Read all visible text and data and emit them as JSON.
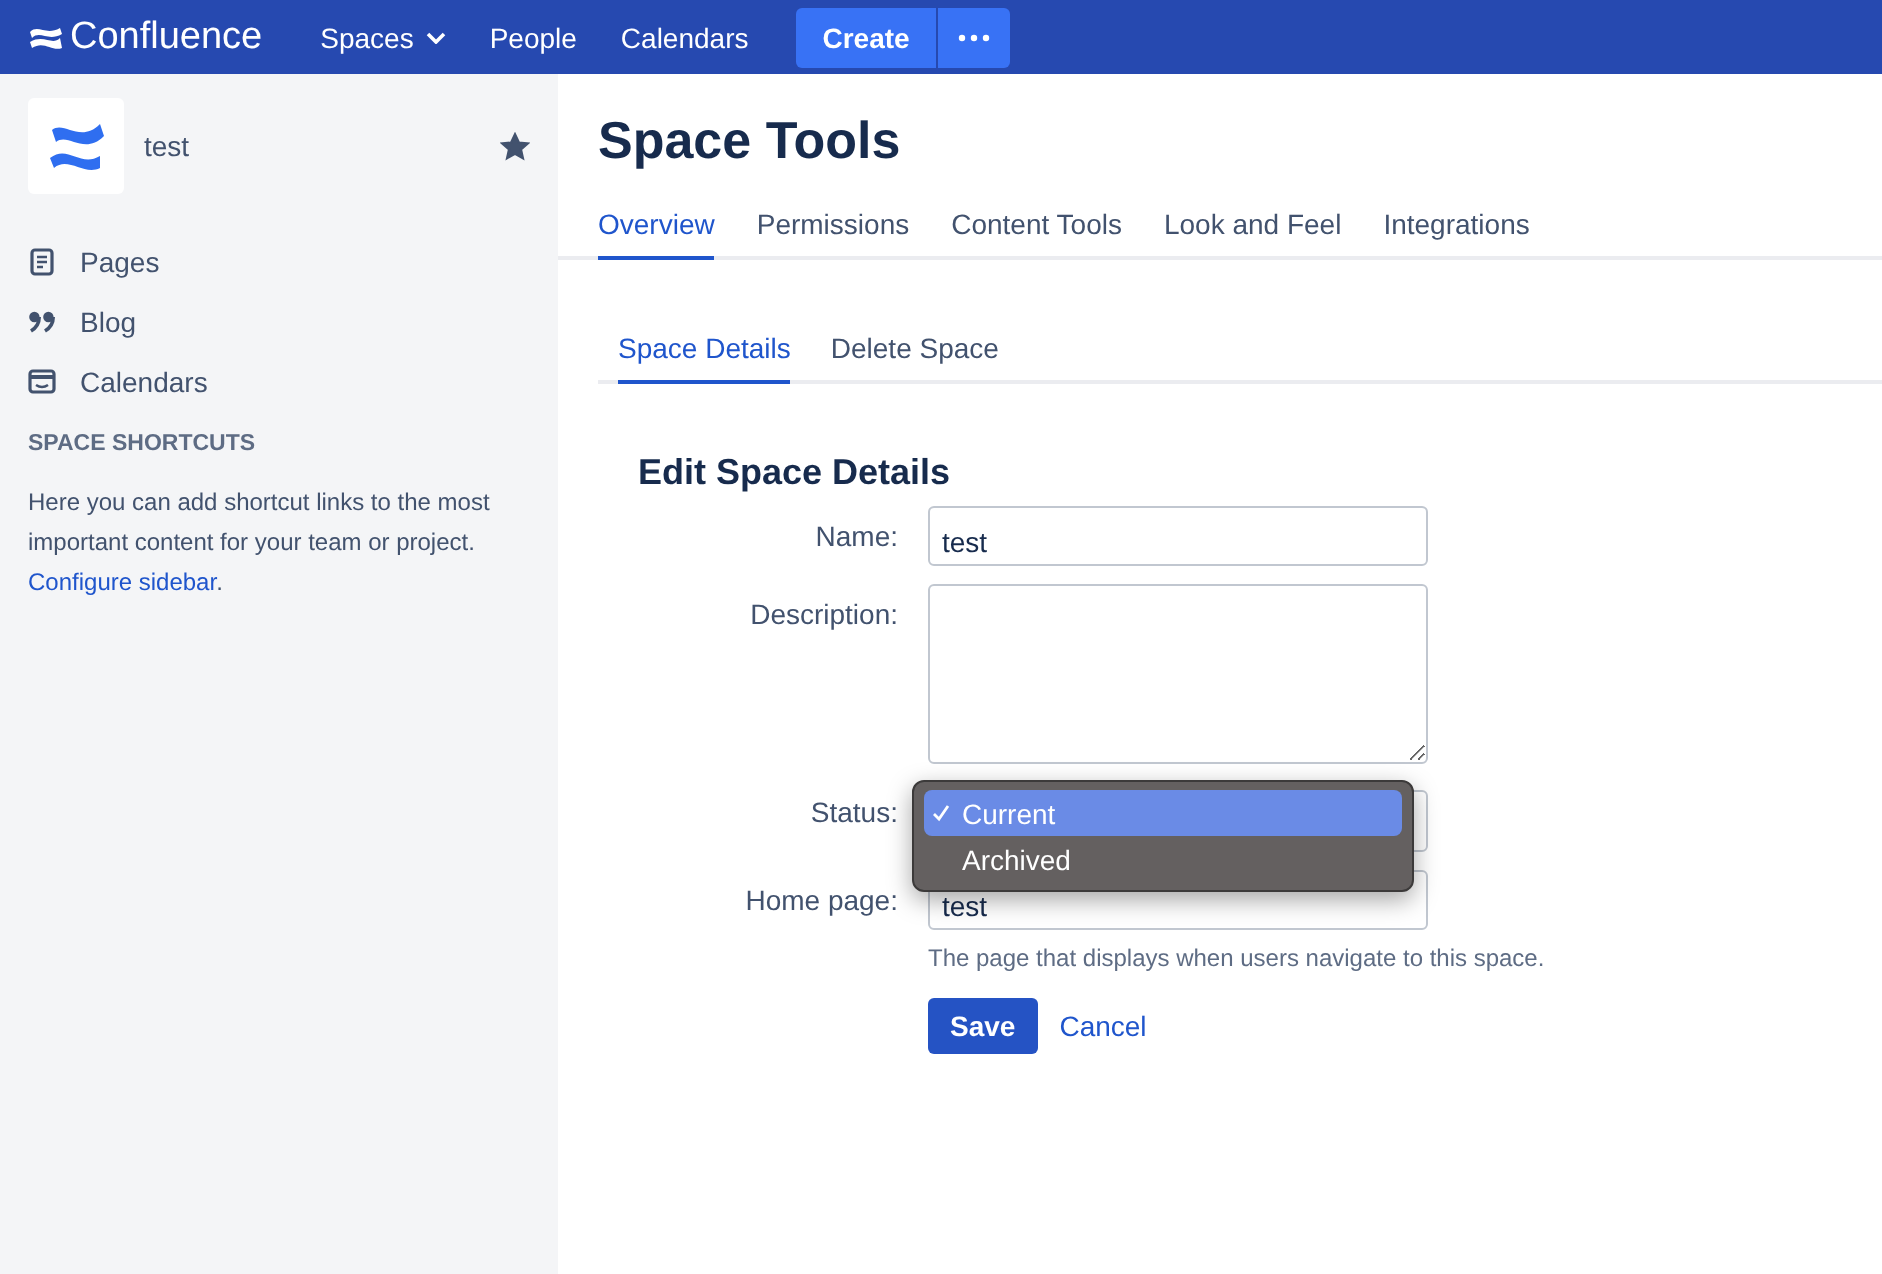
{
  "top_nav": {
    "product": "Confluence",
    "items": [
      {
        "label": "Spaces",
        "kind": "dropdown"
      },
      {
        "label": "People",
        "kind": "link"
      },
      {
        "label": "Calendars",
        "kind": "link"
      }
    ],
    "create_button": "Create"
  },
  "sidebar": {
    "space_name": "test",
    "starred": true,
    "items": [
      {
        "label": "Pages",
        "kind": "page"
      },
      {
        "label": "Blog",
        "kind": "blog"
      },
      {
        "label": "Calendars",
        "kind": "calendar"
      }
    ],
    "section_heading": "SPACE SHORTCUTS",
    "shortcuts_text": "Here you can add shortcut links to the most important content for your team or project.",
    "shortcuts_link": "Configure sidebar",
    "shortcuts_after": "."
  },
  "main": {
    "title": "Space Tools",
    "tabs": [
      {
        "label": "Overview",
        "selected": true
      },
      {
        "label": "Permissions",
        "selected": false
      },
      {
        "label": "Content Tools",
        "selected": false
      },
      {
        "label": "Look and Feel",
        "selected": false
      },
      {
        "label": "Integrations",
        "selected": false
      }
    ],
    "subtabs": [
      {
        "label": "Space Details",
        "selected": true
      },
      {
        "label": "Delete Space",
        "selected": false
      }
    ],
    "form_title": "Edit Space Details",
    "fields": [
      {
        "label": "Name:",
        "kind": "text",
        "value": "test"
      },
      {
        "label": "Description:",
        "kind": "textarea"
      },
      {
        "label": "Status:",
        "kind": "select",
        "expanded": true,
        "options": [
          {
            "label": "Current",
            "selected": true
          },
          {
            "label": "Archived",
            "selected": false
          }
        ]
      },
      {
        "label": "Home page:",
        "kind": "text",
        "value": "test",
        "help": "The page that displays when users navigate to this space."
      }
    ],
    "save_button": "Save",
    "cancel_link": "Cancel"
  }
}
